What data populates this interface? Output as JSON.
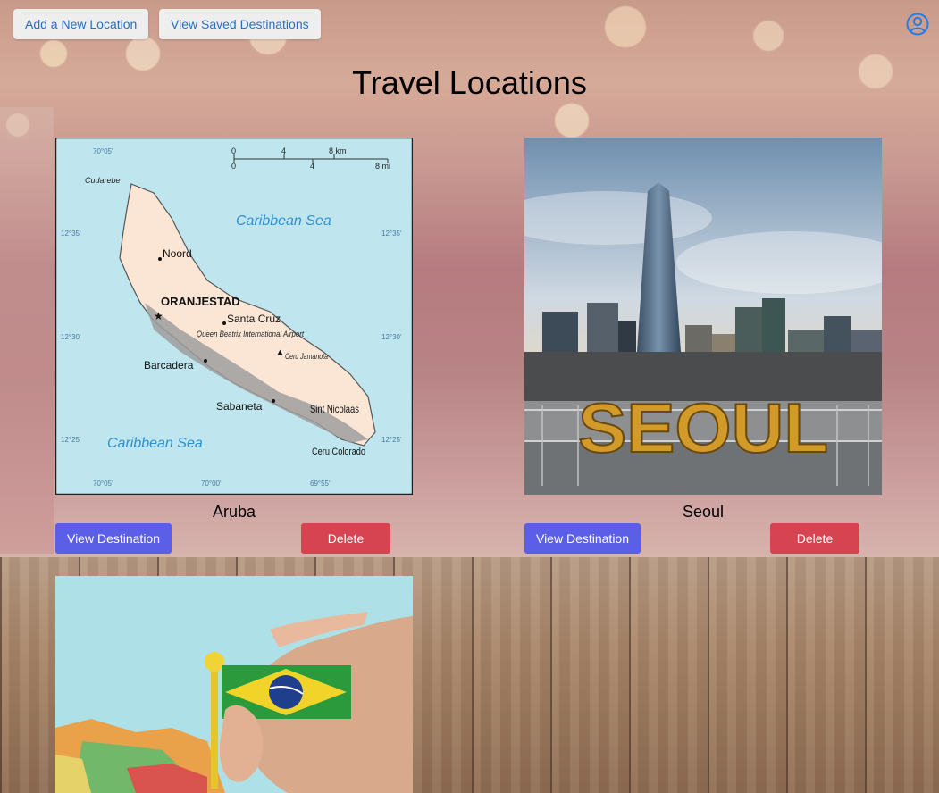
{
  "nav": {
    "add_location_label": "Add a New Location",
    "saved_destinations_label": "View Saved Destinations",
    "profile_icon": "user-circle-icon"
  },
  "page": {
    "title": "Travel Locations"
  },
  "colors": {
    "nav_button_bg": "#eeeeee",
    "nav_button_text": "#2a6ebb",
    "view_button": "#5b5fe8",
    "delete_button": "#d54450",
    "profile_icon": "#2a7be4"
  },
  "locations": [
    {
      "name": "Aruba",
      "image": "aruba-map-image",
      "view_label": "View Destination",
      "delete_label": "Delete",
      "map_labels": {
        "caribbean_top": "Caribbean Sea",
        "caribbean_bottom": "Caribbean Sea",
        "noord": "Noord",
        "oranjestad": "ORANJESTAD",
        "santa_cruz": "Santa Cruz",
        "airport": "Queen Beatrix International Airport",
        "ceru_jamanota": "Ceru Jamanota",
        "barcadera": "Barcadera",
        "sabaneta": "Sabaneta",
        "sint_nicolaas": "Sint Nicolaas",
        "ceru_colorado": "Ceru Colorado",
        "cudarebe": "Cudarebe",
        "lon_left": "70°05'",
        "lon_mid": "70°00'",
        "lon_right": "69°55'",
        "lat_top": "12°35'",
        "lat_mid": "12°30'",
        "lat_bottom": "12°25'",
        "scale_km": "8 km",
        "scale_mi": "8 mi",
        "scale_0": "0",
        "scale_4": "4"
      }
    },
    {
      "name": "Seoul",
      "image": "seoul-skyline-image",
      "view_label": "View Destination",
      "delete_label": "Delete",
      "sign_text": "SEOUL"
    },
    {
      "name": "",
      "image": "brazil-flag-map-image"
    }
  ]
}
